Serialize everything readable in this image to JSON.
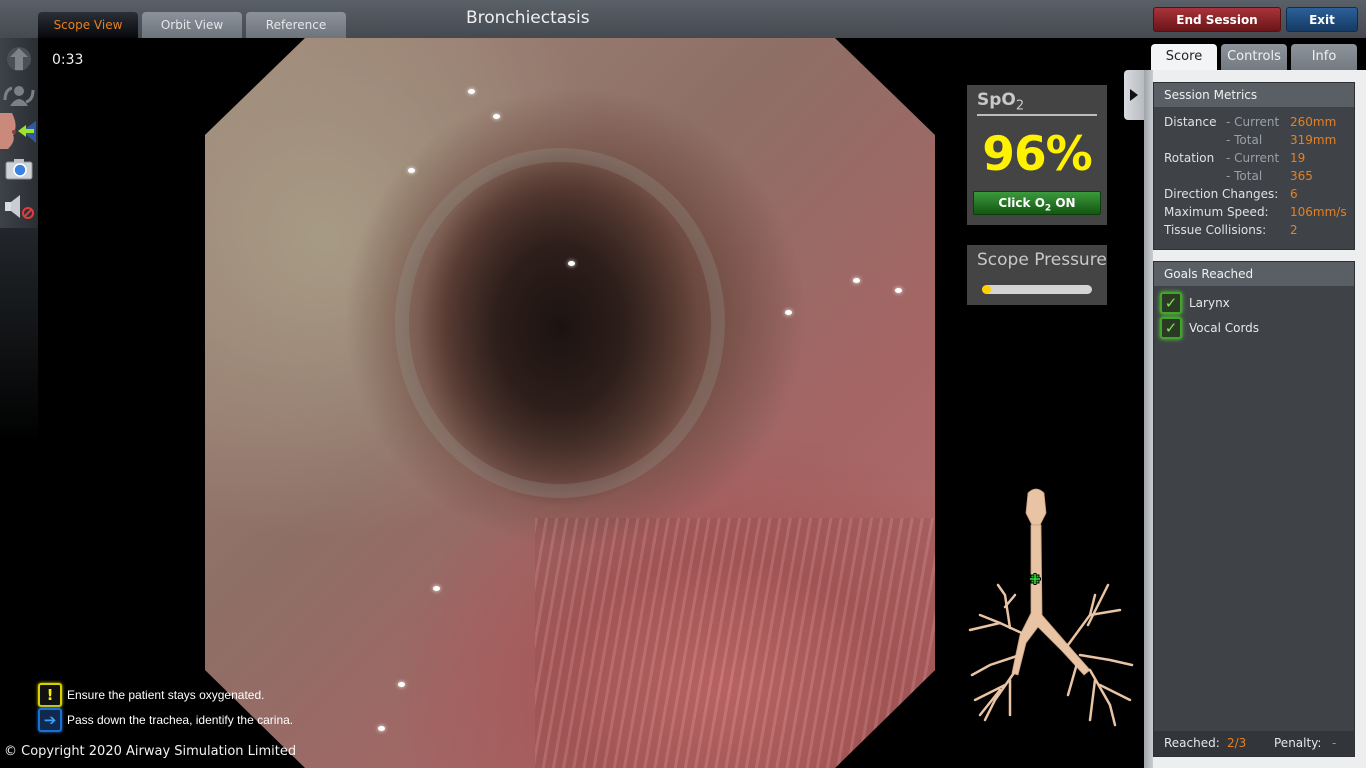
{
  "header": {
    "title": "Bronchiectasis",
    "view_tabs": [
      {
        "label": "Scope View",
        "active": true
      },
      {
        "label": "Orbit View",
        "active": false
      },
      {
        "label": "Reference",
        "active": false
      }
    ],
    "end_session_label": "End Session",
    "exit_label": "Exit"
  },
  "toolbar": {
    "tools": [
      {
        "icon": "advance-scope-icon"
      },
      {
        "icon": "reposition-patient-icon"
      },
      {
        "icon": "patient-breath-icon"
      },
      {
        "icon": "camera-icon"
      },
      {
        "icon": "sound-muted-icon"
      }
    ]
  },
  "timer": "0:33",
  "spo2": {
    "label": "SpO",
    "label_sub": "2",
    "value": "96%",
    "button_prefix": "Click O",
    "button_sub": "2",
    "button_suffix": " ON",
    "value_color": "#fff200"
  },
  "scope_pressure": {
    "label": "Scope Pressure",
    "level_percent": 8
  },
  "right_panel": {
    "tabs": [
      {
        "label": "Score",
        "active": true
      },
      {
        "label": "Controls",
        "active": false
      },
      {
        "label": "Info",
        "active": false
      }
    ],
    "session_metrics": {
      "title": "Session Metrics",
      "rows": [
        {
          "name": "Distance",
          "sub": "- Current",
          "value": "260mm"
        },
        {
          "name": "",
          "sub": "- Total",
          "value": "319mm"
        },
        {
          "name": "Rotation",
          "sub": "- Current",
          "value": "19"
        },
        {
          "name": "",
          "sub": "- Total",
          "value": "365"
        },
        {
          "name": "Direction Changes:",
          "sub": "",
          "value": "6"
        },
        {
          "name": "Maximum Speed:",
          "sub": "",
          "value": "106mm/s"
        },
        {
          "name": "Tissue Collisions:",
          "sub": "",
          "value": "2"
        }
      ]
    },
    "goals": {
      "title": "Goals Reached",
      "items": [
        {
          "label": "Larynx",
          "checked": true
        },
        {
          "label": "Vocal Cords",
          "checked": true
        }
      ],
      "reached_label": "Reached:",
      "reached_value": "2/3",
      "penalty_label": "Penalty:",
      "penalty_value": "-"
    }
  },
  "instructions": [
    {
      "icon": "warning-icon",
      "glyph": "!",
      "text": "Ensure the patient stays oxygenated."
    },
    {
      "icon": "arrow-right-icon",
      "glyph": "➔",
      "text": "Pass down the trachea, identify the carina."
    }
  ],
  "copyright": "© Copyright 2020 Airway Simulation Limited",
  "colors": {
    "accent_orange": "#e8801f",
    "end_session": "#8b2227",
    "exit": "#1f4c7e",
    "o2_button": "#2a7a2a",
    "goal_check": "#41a527"
  }
}
